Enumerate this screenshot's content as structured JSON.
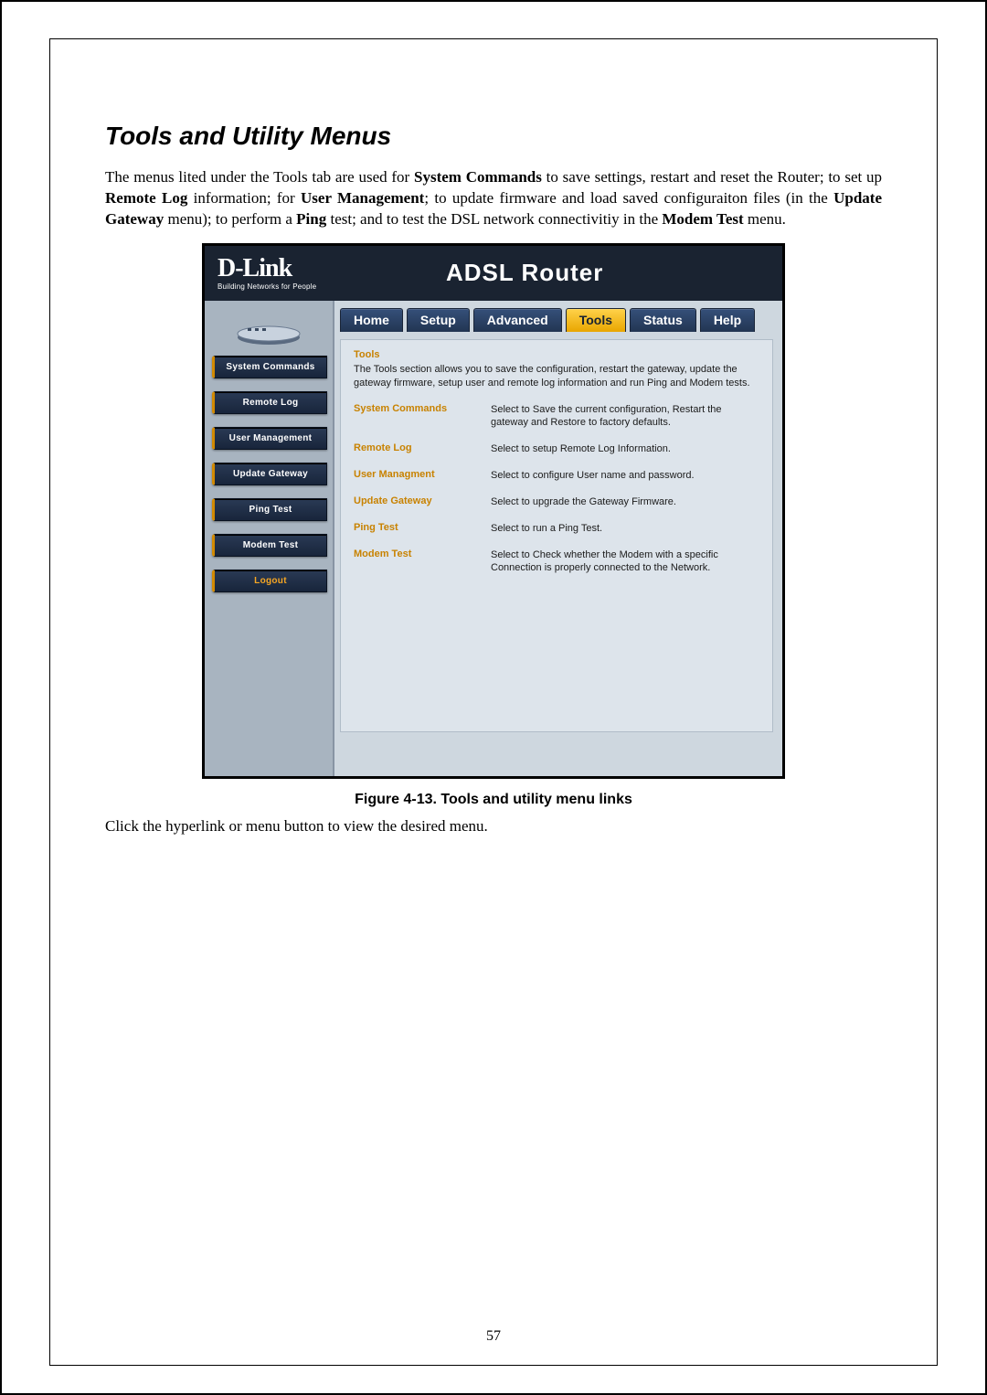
{
  "section_title": "Tools and Utility Menus",
  "intro_paragraph": {
    "parts": [
      {
        "t": "The menus lited under the Tools tab are used for "
      },
      {
        "t": "System Commands",
        "b": true
      },
      {
        "t": " to save settings, restart and reset the Router; to set up "
      },
      {
        "t": "Remote Log",
        "b": true
      },
      {
        "t": " information; for "
      },
      {
        "t": "User Management",
        "b": true
      },
      {
        "t": "; to update firmware and load saved configuraiton files (in the "
      },
      {
        "t": "Update Gateway",
        "b": true
      },
      {
        "t": " menu); to perform a "
      },
      {
        "t": "Ping",
        "b": true
      },
      {
        "t": " test; and to test the DSL network connectivitiy in the "
      },
      {
        "t": "Modem Test",
        "b": true
      },
      {
        "t": " menu."
      }
    ]
  },
  "router": {
    "brand_big": "D-Link",
    "brand_small": "Building Networks for People",
    "header_title": "ADSL Router",
    "tabs": [
      {
        "label": "Home",
        "active": false
      },
      {
        "label": "Setup",
        "active": false
      },
      {
        "label": "Advanced",
        "active": false
      },
      {
        "label": "Tools",
        "active": true
      },
      {
        "label": "Status",
        "active": false
      },
      {
        "label": "Help",
        "active": false
      }
    ],
    "sidebar": [
      {
        "label": "System Commands",
        "name": "side-system-commands"
      },
      {
        "label": "Remote Log",
        "name": "side-remote-log"
      },
      {
        "label": "User Management",
        "name": "side-user-management"
      },
      {
        "label": "Update Gateway",
        "name": "side-update-gateway"
      },
      {
        "label": "Ping Test",
        "name": "side-ping-test"
      },
      {
        "label": "Modem Test",
        "name": "side-modem-test"
      }
    ],
    "logout_label": "Logout",
    "content": {
      "title": "Tools",
      "desc": "The Tools section allows you to save the configuration, restart the gateway, update the gateway firmware, setup user and remote log information and run Ping and Modem tests.",
      "rows": [
        {
          "link": "System Commands",
          "desc": "Select to Save the current configuration, Restart the gateway and Restore to factory defaults."
        },
        {
          "link": "Remote Log",
          "desc": "Select to setup Remote Log Information."
        },
        {
          "link": "User Managment",
          "desc": "Select to configure User name and password."
        },
        {
          "link": "Update Gateway",
          "desc": "Select to upgrade the Gateway Firmware."
        },
        {
          "link": "Ping Test",
          "desc": "Select to run a Ping Test."
        },
        {
          "link": "Modem Test",
          "desc": "Select to Check whether the Modem with a specific Connection is properly connected to the Network."
        }
      ]
    }
  },
  "figure_caption": "Figure 4-13. Tools and utility menu links",
  "after_text": "Click the hyperlink or menu button to view the desired menu.",
  "page_number": "57"
}
